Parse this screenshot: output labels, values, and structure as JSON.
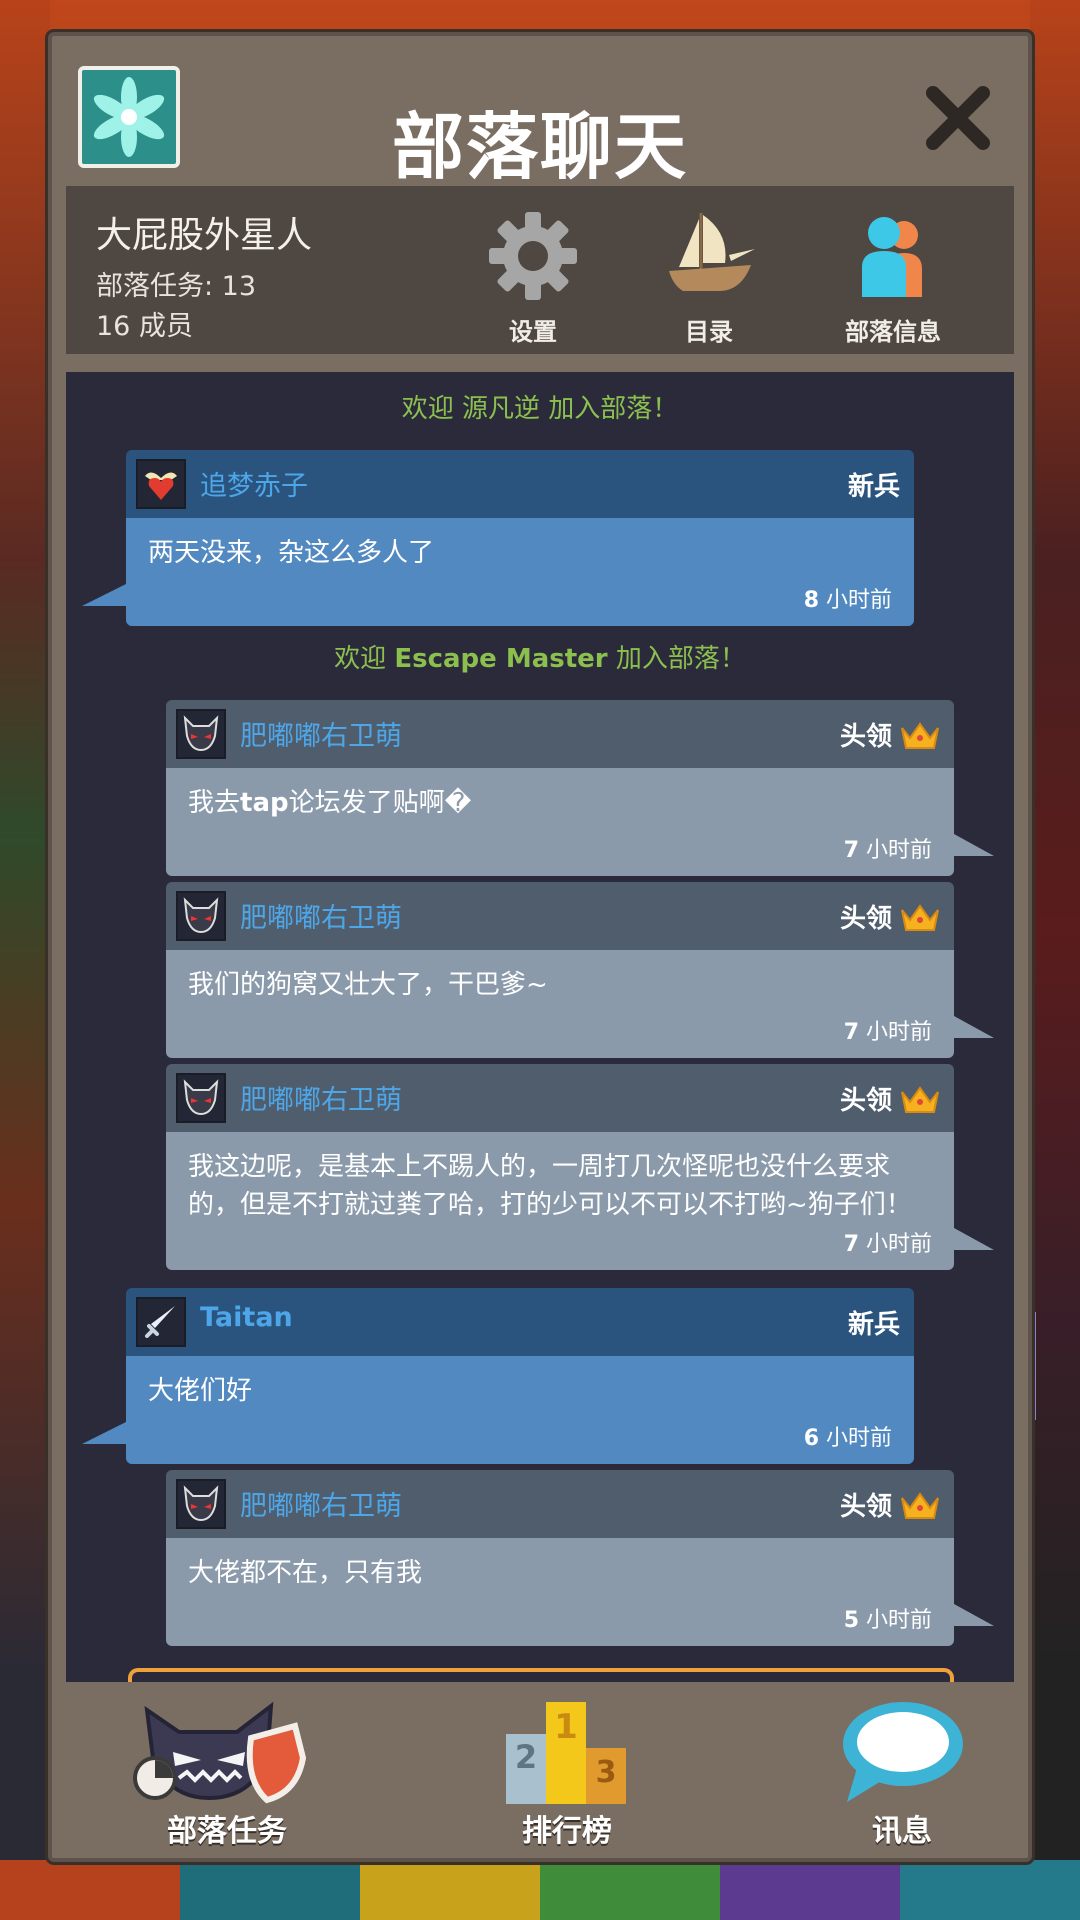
{
  "header": {
    "title": "部落聊天",
    "close_icon": "close-x-icon",
    "tribe_icon": "flower-icon"
  },
  "tribe": {
    "name": "大屁股外星人",
    "quests": "部落任务: 13",
    "members": "16 成员"
  },
  "actions": [
    {
      "label": "设置",
      "icon": "gear-icon"
    },
    {
      "label": "目录",
      "icon": "ship-icon"
    },
    {
      "label": "部落信息",
      "icon": "members-icon"
    }
  ],
  "system_messages": [
    {
      "prefix": "欢迎 ",
      "name": "源凡逆",
      "suffix": " 加入部落！"
    },
    {
      "prefix": "欢迎 ",
      "name": "Escape Master",
      "suffix": " 加入部落！"
    }
  ],
  "messages": [
    {
      "user": "追梦赤子",
      "role": "新兵",
      "text": "两天没来，杂这么多人了",
      "time_num": "8",
      "time_unit": " 小时前"
    },
    {
      "user": "肥嘟嘟右卫萌",
      "role": "头领",
      "text_pre": "我去",
      "text_bold": "tap",
      "text_post": "论坛发了贴啊�",
      "time_num": "7",
      "time_unit": " 小时前"
    },
    {
      "user": "肥嘟嘟右卫萌",
      "role": "头领",
      "text": "我们的狗窝又壮大了，干巴爹~",
      "time_num": "7",
      "time_unit": " 小时前"
    },
    {
      "user": "肥嘟嘟右卫萌",
      "role": "头领",
      "text": "我这边呢，是基本上不踢人的，一周打几次怪呢也没什么要求的，但是不打就过粪了哈，打的少可以不可以不打哟~狗子们！",
      "time_num": "7",
      "time_unit": " 小时前"
    },
    {
      "user": "Taitan",
      "role": "新兵",
      "text": "大佬们好",
      "time_num": "6",
      "time_unit": " 小时前"
    },
    {
      "user": "肥嘟嘟右卫萌",
      "role": "头领",
      "text": "大佬都不在，只有我",
      "time_num": "5",
      "time_unit": " 小时前"
    }
  ],
  "footer": [
    {
      "label": "部落任务",
      "icon": "tribe-quest-icon"
    },
    {
      "label": "排行榜",
      "icon": "podium-icon"
    },
    {
      "label": "讯息",
      "icon": "speech-bubble-icon"
    }
  ],
  "colors": {
    "panel": "#7a6d62",
    "chat_bg": "#2b2a3b",
    "system_text": "#8cc04e",
    "username": "#4da6e8",
    "recruit_head": "#2a547e",
    "recruit_body": "#5289c0",
    "leader_head": "#505d6c",
    "leader_body": "#8b9aaa"
  }
}
